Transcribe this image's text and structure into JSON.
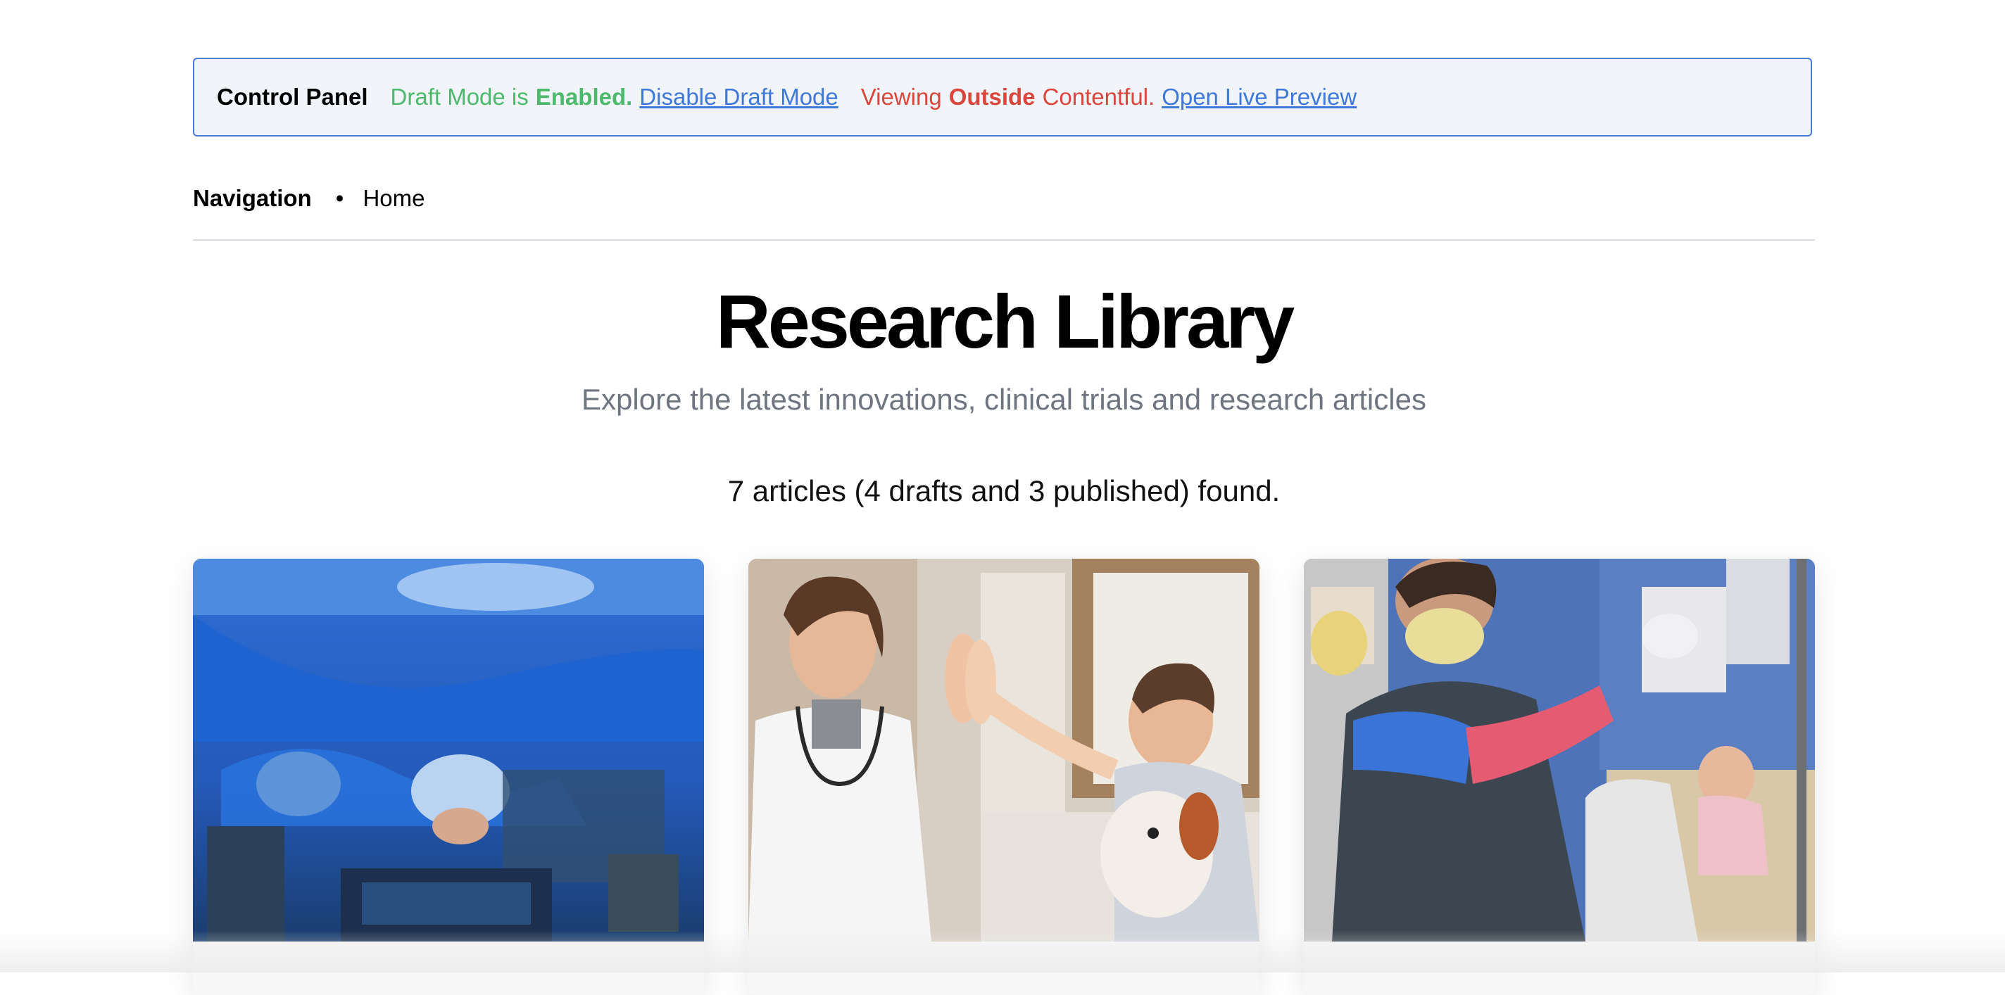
{
  "control_panel": {
    "title": "Control Panel",
    "draft_prefix": "Draft Mode is",
    "draft_state": "Enabled.",
    "disable_link": "Disable Draft Mode",
    "viewing_prefix": "Viewing",
    "viewing_state": "Outside",
    "viewing_suffix": "Contentful.",
    "preview_link": "Open Live Preview"
  },
  "navigation": {
    "title": "Navigation",
    "items": [
      {
        "label": "Home"
      }
    ]
  },
  "page": {
    "title": "Research Library",
    "subtitle": "Explore the latest innovations, clinical trials and research articles",
    "count": "7 articles (4 drafts and 3 published) found."
  },
  "cards": [
    {
      "image": "surgeons-operating-room-photo"
    },
    {
      "image": "doctor-child-high-five-photo"
    },
    {
      "image": "nurse-iv-pump-hospital-photo"
    }
  ],
  "colors": {
    "panel_border": "#4a7bd6",
    "panel_bg": "#f1f5fa",
    "draft_green": "#4cb96b",
    "viewing_red": "#d9463c",
    "link_blue": "#3f78d8"
  }
}
